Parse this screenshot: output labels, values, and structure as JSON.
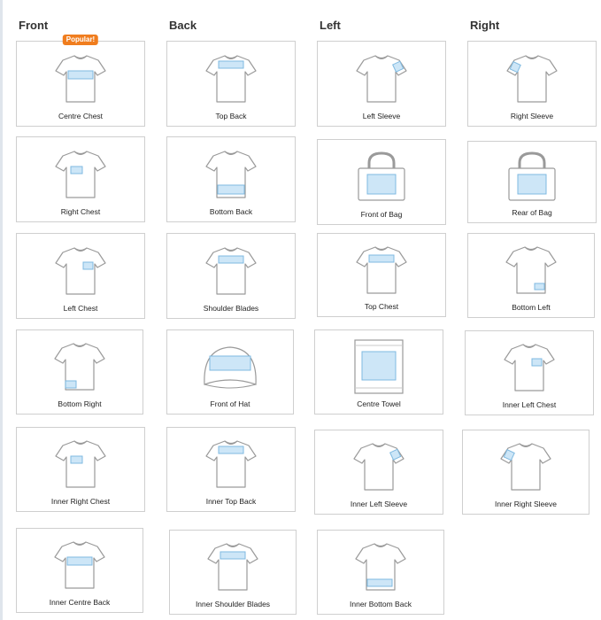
{
  "columns": [
    "Front",
    "Back",
    "Left",
    "Right"
  ],
  "popular_badge": "Popular!",
  "colors": {
    "garment_stroke": "#9a9a9a",
    "print_area_fill": "#cde6f7",
    "print_area_stroke": "#7fb9e0",
    "badge": "#f07d1e"
  },
  "positions": [
    {
      "label": "Centre Chest",
      "icon": "tshirt-icon",
      "area": "centre-chest",
      "popular": true
    },
    {
      "label": "Top Back",
      "icon": "tshirt-icon",
      "area": "top-back"
    },
    {
      "label": "Left Sleeve",
      "icon": "tshirt-icon",
      "area": "left-sleeve"
    },
    {
      "label": "Right Sleeve",
      "icon": "tshirt-icon",
      "area": "right-sleeve"
    },
    {
      "label": "Right Chest",
      "icon": "tshirt-icon",
      "area": "right-chest"
    },
    {
      "label": "Bottom Back",
      "icon": "tshirt-icon",
      "area": "bottom-back"
    },
    {
      "label": "Front of Bag",
      "icon": "bag-icon",
      "area": "bag"
    },
    {
      "label": "Rear of Bag",
      "icon": "bag-icon",
      "area": "bag"
    },
    {
      "label": "Left Chest",
      "icon": "tshirt-icon",
      "area": "left-chest"
    },
    {
      "label": "Shoulder Blades",
      "icon": "tshirt-icon",
      "area": "shoulder-blades"
    },
    {
      "label": "Top Chest",
      "icon": "tshirt-icon",
      "area": "top-chest"
    },
    {
      "label": "Bottom Left",
      "icon": "tshirt-icon",
      "area": "bottom-left"
    },
    {
      "label": "Bottom Right",
      "icon": "tshirt-icon",
      "area": "bottom-right"
    },
    {
      "label": "Front of Hat",
      "icon": "hat-icon",
      "area": "hat"
    },
    {
      "label": "Centre Towel",
      "icon": "towel-icon",
      "area": "towel"
    },
    {
      "label": "Inner Left Chest",
      "icon": "tshirt-icon",
      "area": "inner-left-chest"
    },
    {
      "label": "Inner Right Chest",
      "icon": "tshirt-icon",
      "area": "inner-right-chest"
    },
    {
      "label": "Inner Top Back",
      "icon": "tshirt-icon",
      "area": "inner-top-back"
    },
    {
      "label": "Inner Left Sleeve",
      "icon": "tshirt-icon",
      "area": "inner-left-sleeve"
    },
    {
      "label": "Inner Right Sleeve",
      "icon": "tshirt-icon",
      "area": "inner-right-sleeve"
    },
    {
      "label": "Inner Centre Back",
      "icon": "tshirt-icon",
      "area": "inner-centre-back"
    },
    {
      "label": "Inner Shoulder Blades",
      "icon": "tshirt-icon",
      "area": "inner-shoulder-blades"
    },
    {
      "label": "Inner Bottom Back",
      "icon": "tshirt-icon",
      "area": "inner-bottom-back"
    }
  ]
}
